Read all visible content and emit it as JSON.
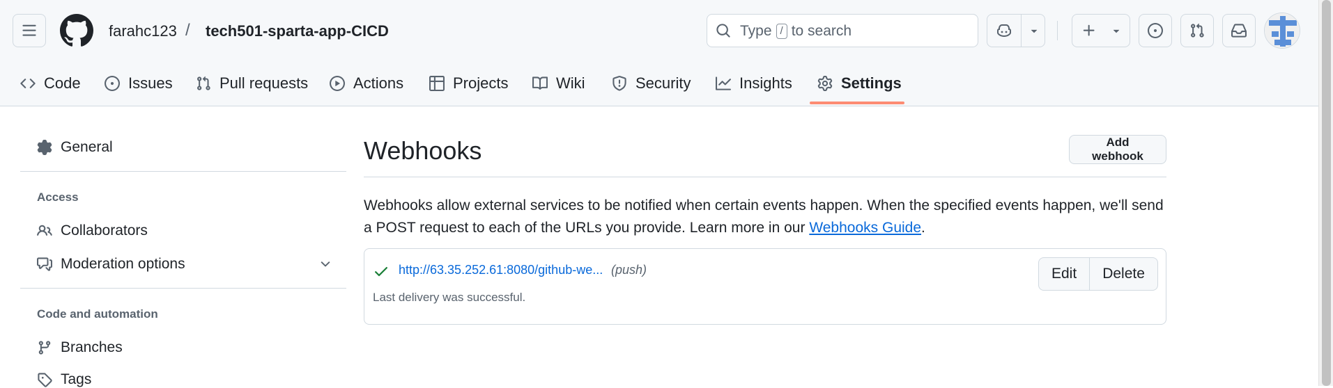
{
  "header": {
    "owner": "farahc123",
    "separator": "/",
    "repo": "tech501-sparta-app-CICD",
    "search": {
      "prefix": "Type",
      "key": "/",
      "suffix": "to search"
    }
  },
  "nav": {
    "tabs": [
      {
        "label": "Code",
        "icon": "code-icon"
      },
      {
        "label": "Issues",
        "icon": "issue-icon"
      },
      {
        "label": "Pull requests",
        "icon": "pull-request-icon"
      },
      {
        "label": "Actions",
        "icon": "play-icon"
      },
      {
        "label": "Projects",
        "icon": "table-icon"
      },
      {
        "label": "Wiki",
        "icon": "book-icon"
      },
      {
        "label": "Security",
        "icon": "shield-icon"
      },
      {
        "label": "Insights",
        "icon": "graph-icon"
      },
      {
        "label": "Settings",
        "icon": "gear-icon"
      }
    ],
    "active": "Settings"
  },
  "sidebar": {
    "general": "General",
    "access_heading": "Access",
    "collaborators": "Collaborators",
    "moderation": "Moderation options",
    "code_heading": "Code and automation",
    "branches": "Branches",
    "tags": "Tags"
  },
  "main": {
    "title": "Webhooks",
    "add_button": "Add webhook",
    "description": "Webhooks allow external services to be notified when certain events happen. When the specified events happen, we'll send a POST request to each of the URLs you provide. Learn more in our",
    "guide_link": "Webhooks Guide",
    "period": ".",
    "webhook": {
      "url": "http://63.35.252.61:8080/github-we...",
      "events": "(push)",
      "status": "Last delivery was successful.",
      "edit_label": "Edit",
      "delete_label": "Delete"
    }
  },
  "colors": {
    "accent_underline": "#fd8c73",
    "link": "#0969da",
    "success": "#1a7f37",
    "border": "#d1d9e0"
  }
}
